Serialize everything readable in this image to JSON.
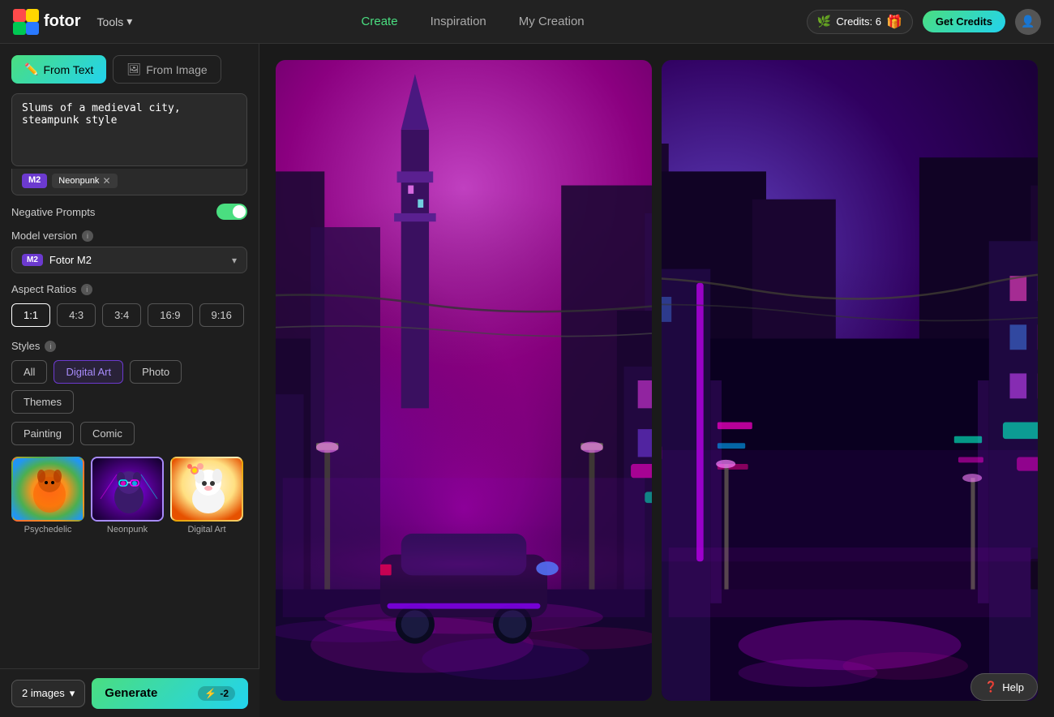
{
  "header": {
    "logo_text": "fotor",
    "tools_label": "Tools",
    "nav": [
      {
        "label": "Create",
        "active": true
      },
      {
        "label": "Inspiration",
        "active": false
      },
      {
        "label": "My Creation",
        "active": false
      }
    ],
    "credits_label": "Credits: 6",
    "get_credits_label": "Get Credits"
  },
  "sidebar": {
    "tab_from_text": "From Text",
    "tab_from_image": "From Image",
    "prompt_placeholder": "Slums of a medieval city, steampunk style",
    "prompt_value": "Slums of a medieval city, steampunk style",
    "tag_m2": "M2",
    "tag_neonpunk": "Neonpunk",
    "negative_prompts_label": "Negative Prompts",
    "model_version_label": "Model version",
    "model_name": "Fotor M2",
    "model_tag": "M2",
    "aspect_ratios_label": "Aspect Ratios",
    "aspect_options": [
      "1:1",
      "4:3",
      "3:4",
      "16:9",
      "9:16"
    ],
    "aspect_active": "1:1",
    "styles_label": "Styles",
    "style_tabs": [
      "All",
      "Digital Art",
      "Photo",
      "Themes",
      "Painting",
      "Comic"
    ],
    "style_active": "Digital Art",
    "style_images": [
      {
        "label": "Psychedelic",
        "type": "psychedelic"
      },
      {
        "label": "Neonpunk",
        "type": "neonpunk",
        "selected": true
      },
      {
        "label": "Digital Art",
        "type": "digitalart"
      }
    ],
    "images_count": "2 images",
    "generate_label": "Generate",
    "generate_cost": "-2"
  },
  "help": {
    "label": "Help"
  }
}
